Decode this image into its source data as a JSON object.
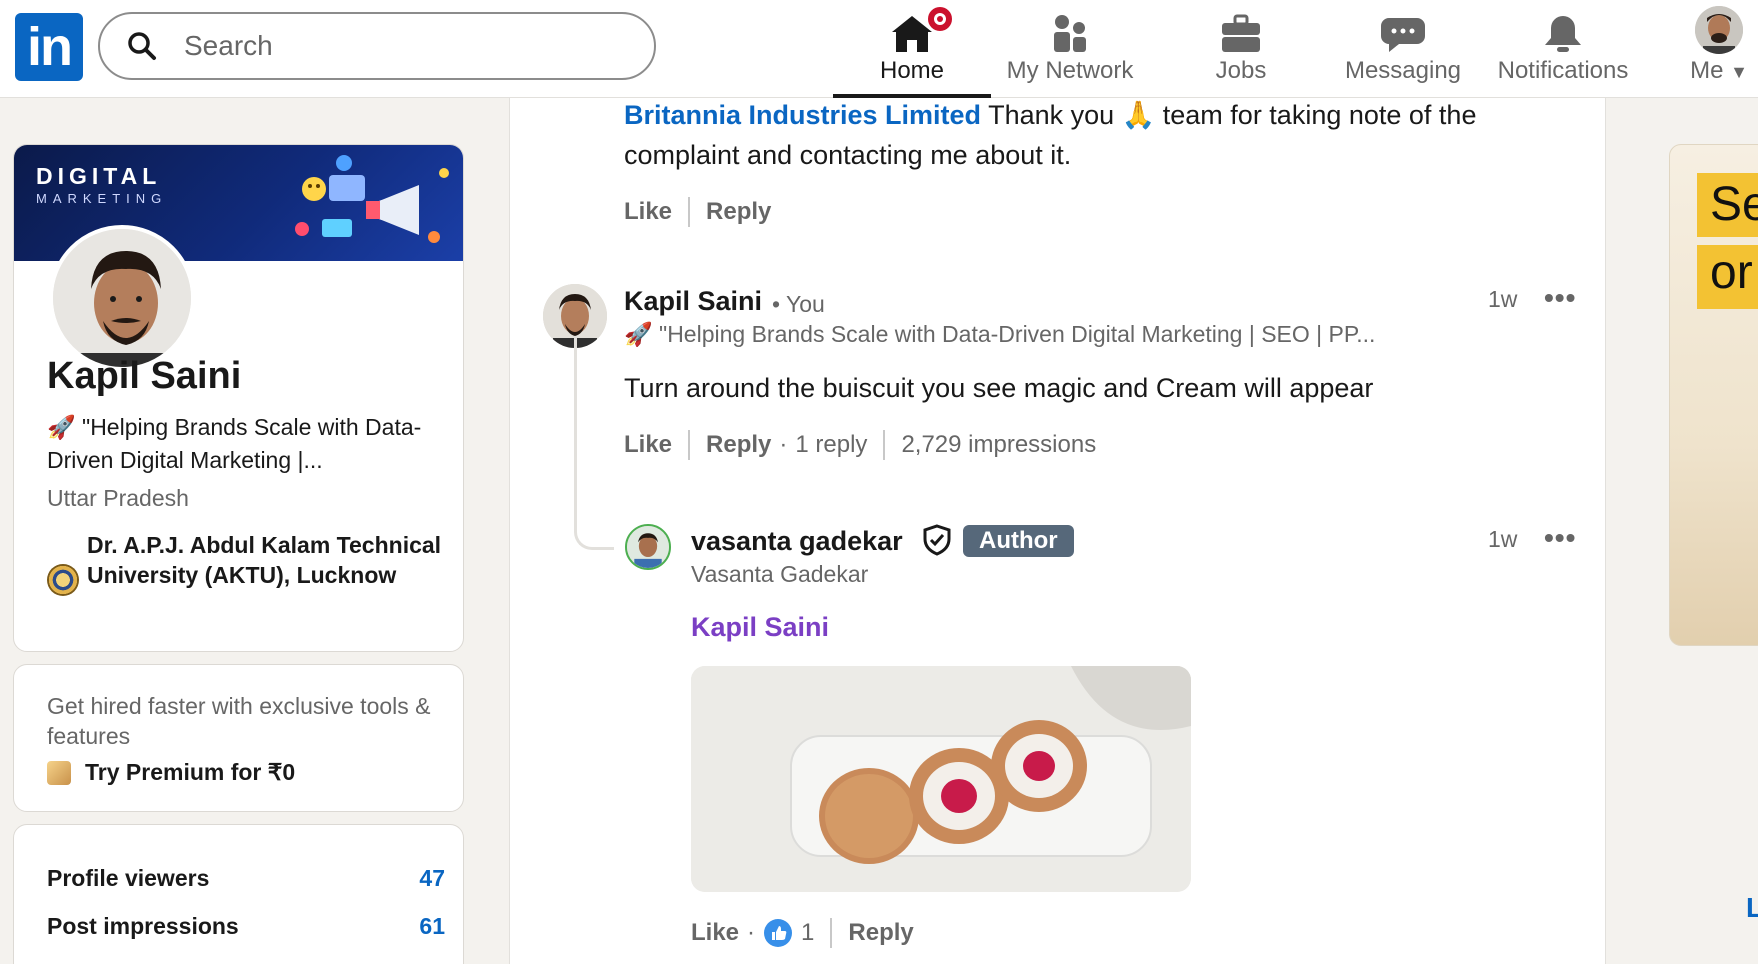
{
  "nav": {
    "logo": "in",
    "search_placeholder": "Search",
    "items": [
      {
        "label": "Home"
      },
      {
        "label": "My Network"
      },
      {
        "label": "Jobs"
      },
      {
        "label": "Messaging"
      },
      {
        "label": "Notifications"
      },
      {
        "label": "Me"
      }
    ]
  },
  "profile": {
    "banner_title": "DIGITAL",
    "banner_subtitle": "MARKETING",
    "name": "Kapil Saini",
    "headline": "🚀 \"Helping Brands Scale with Data-Driven Digital Marketing |...",
    "location": "Uttar Pradesh",
    "education": "Dr. A.P.J. Abdul Kalam Technical University (AKTU), Lucknow"
  },
  "premium": {
    "text": "Get hired faster with exclusive tools & features",
    "cta": "Try Premium for ₹0"
  },
  "stats": [
    {
      "label": "Profile viewers",
      "value": "47"
    },
    {
      "label": "Post impressions",
      "value": "61"
    }
  ],
  "comment_prev": {
    "mention": "Britannia Industries Limited",
    "text_a": " Thank you 🙏 team for taking note of the",
    "text_b": "complaint and contacting me about it.",
    "like": "Like",
    "reply": "Reply"
  },
  "comment_main": {
    "name": "Kapil Saini",
    "you": "• You",
    "headline": "🚀 \"Helping Brands Scale with Data-Driven Digital Marketing | SEO | PP...",
    "time": "1w",
    "more": "•••",
    "text": "Turn around the buiscuit you see magic and Cream will appear",
    "like": "Like",
    "reply": "Reply",
    "replies": "1 reply",
    "impressions": "2,729 impressions"
  },
  "reply": {
    "name": "vasanta gadekar",
    "badge": "Author",
    "sub": "Vasanta Gadekar",
    "time": "1w",
    "more": "•••",
    "mention": "Kapil Saini",
    "like": "Like",
    "reactions": "1",
    "reply": "Reply"
  },
  "ad": {
    "line1": "Se",
    "line2": "or"
  },
  "right_link": "L"
}
